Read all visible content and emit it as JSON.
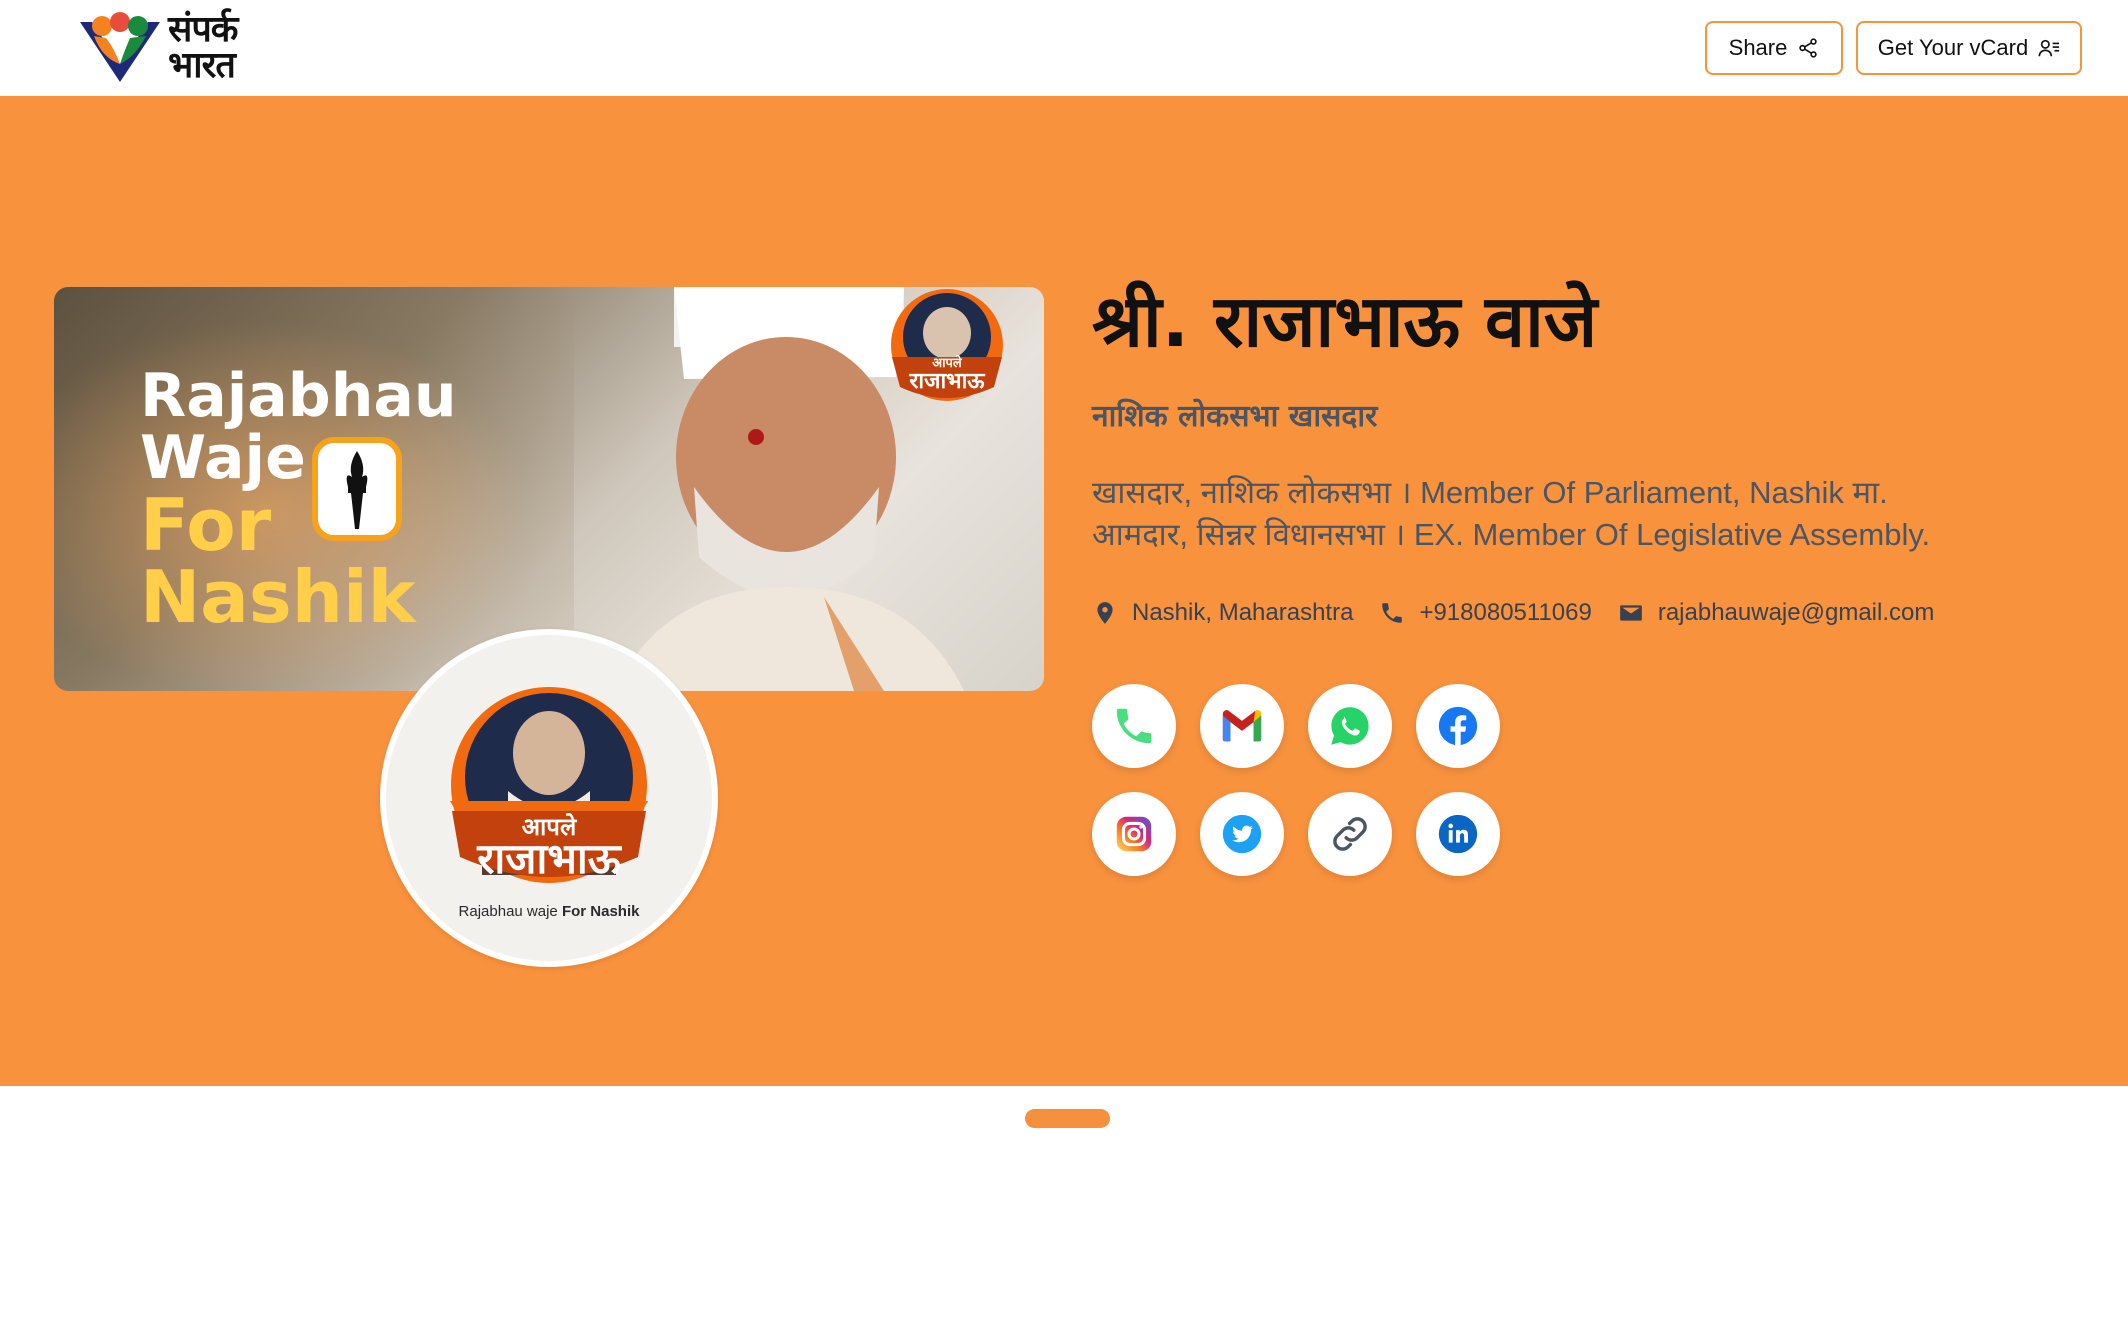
{
  "header": {
    "logo_line1": "संपर्क",
    "logo_line2": "भारत",
    "share_label": "Share",
    "vcard_label": "Get Your vCard"
  },
  "banner": {
    "line1": "Rajabhau",
    "line2": "Waje",
    "line3": "For",
    "line4": "Nashik",
    "badge_text": "आपले राजाभाऊ"
  },
  "profile": {
    "badge_top": "आपले",
    "badge_main": "राजाभाऊ",
    "caption_prefix": "Rajabhau waje ",
    "caption_bold": "For Nashik",
    "name": "श्री. राजाभाऊ वाजे",
    "subtitle": "नाशिक लोकसभा खासदार",
    "desc_line1": "खासदार, नाशिक लोकसभा । Member Of Parliament, Nashik मा.",
    "desc_line2": "आमदार, सिन्नर विधानसभा । EX. Member Of Legislative Assembly.",
    "location": "Nashik, Maharashtra",
    "phone": "+918080511069",
    "email": "rajabhauwaje@gmail.com"
  },
  "socials": [
    "phone-icon",
    "gmail-icon",
    "whatsapp-icon",
    "facebook-icon",
    "instagram-icon",
    "twitter-icon",
    "link-icon",
    "linkedin-icon"
  ],
  "colors": {
    "accent": "#f9923d",
    "button_border": "#f7933b",
    "text_dark": "#111111",
    "text_muted": "#4b5563"
  }
}
